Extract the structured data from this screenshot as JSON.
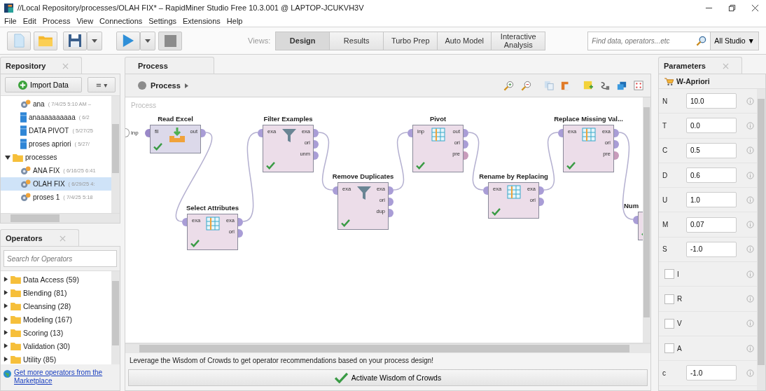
{
  "window": {
    "title": "//Local Repository/processes/OLAH FIX* – RapidMiner Studio Free 10.3.001 @ LAPTOP-JCUKVH3V"
  },
  "menu": [
    "File",
    "Edit",
    "Process",
    "View",
    "Connections",
    "Settings",
    "Extensions",
    "Help"
  ],
  "toolbar": {
    "stop_disabled": true,
    "views_label": "Views:",
    "views": [
      {
        "label": "Design",
        "selected": true
      },
      {
        "label": "Results",
        "selected": false
      },
      {
        "label": "Turbo Prep",
        "selected": false
      },
      {
        "label": "Auto Model",
        "selected": false
      },
      {
        "label": "Interactive Analysis",
        "selected": false
      }
    ],
    "search": {
      "placeholder": "Find data, operators...etc"
    },
    "scope": "All Studio ▼"
  },
  "repository": {
    "tab": "Repository",
    "import_button": "Import Data",
    "menu_button": "≡ ▾",
    "tree": [
      {
        "children": [
          {
            "name": "ana",
            "meta": "( 7/4/25 5:10 AM –",
            "kind": "process",
            "selected": false
          },
          {
            "name": "anaaaaaaaaaa",
            "meta": "( 6/2",
            "kind": "data",
            "selected": false
          },
          {
            "name": "DATA PIVOT",
            "meta": "( 5/27/25",
            "kind": "data",
            "selected": false
          },
          {
            "name": "proses apriori",
            "meta": "( 5/27/",
            "kind": "data",
            "selected": false
          }
        ]
      },
      {
        "name": "processes",
        "kind": "folder",
        "expanded": true,
        "selected": false,
        "children": [
          {
            "name": "ANA FIX",
            "meta": "( 6/16/25 6:41",
            "kind": "process",
            "selected": false
          },
          {
            "name": "OLAH FIX",
            "meta": "( 6/29/25 4:",
            "kind": "process",
            "selected": true
          },
          {
            "name": "proses 1",
            "meta": "( 7/4/25 5:18",
            "kind": "process",
            "selected": false
          }
        ]
      }
    ]
  },
  "operators": {
    "tab": "Operators",
    "search": {
      "placeholder": "Search for Operators"
    },
    "groups": [
      {
        "label": "Data Access (59)",
        "expanded": false
      },
      {
        "label": "Blending (81)",
        "expanded": false
      },
      {
        "label": "Cleansing (28)",
        "expanded": false
      },
      {
        "label": "Modeling (167)",
        "expanded": false
      },
      {
        "label": "Scoring (13)",
        "expanded": false
      },
      {
        "label": "Validation (30)",
        "expanded": false
      },
      {
        "label": "Utility (85)",
        "expanded": false
      }
    ],
    "marketplace_link": "Get more operators from the Marketplace"
  },
  "process": {
    "tab": "Process",
    "breadcrumb": "Process",
    "canvas_label": "Process",
    "input_port": "inp",
    "nodes": [
      {
        "title": "Read Excel",
        "kind": "import",
        "color": "#dcd9ea",
        "ok": true,
        "inputs": [
          {
            "label": "fil",
            "color": "#9a88c8"
          }
        ],
        "outputs": [
          {
            "label": "out",
            "color": "#a99dd6"
          }
        ]
      },
      {
        "title": "Filter Examples",
        "kind": "filter",
        "color": "#ecdde9",
        "ok": true,
        "inputs": [
          {
            "label": "exa",
            "color": "#a99dd6"
          }
        ],
        "outputs": [
          {
            "label": "exa",
            "color": "#a99dd6"
          },
          {
            "label": "ori",
            "color": "#a99dd6"
          },
          {
            "label": "unm",
            "color": "#a99dd6"
          }
        ]
      },
      {
        "title": "Select Attributes",
        "kind": "table",
        "color": "#ecdde9",
        "ok": true,
        "inputs": [
          {
            "label": "exa",
            "color": "#a99dd6"
          }
        ],
        "outputs": [
          {
            "label": "exa",
            "color": "#a99dd6"
          },
          {
            "label": "ori",
            "color": "#a99dd6"
          }
        ]
      },
      {
        "title": "Remove Duplicates",
        "kind": "filter",
        "color": "#ecdde9",
        "ok": true,
        "inputs": [
          {
            "label": "exa",
            "color": "#a99dd6"
          }
        ],
        "outputs": [
          {
            "label": "exa",
            "color": "#a99dd6"
          },
          {
            "label": "ori",
            "color": "#a99dd6"
          },
          {
            "label": "dup",
            "color": "#a99dd6"
          }
        ]
      },
      {
        "title": "Pivot",
        "kind": "table",
        "color": "#ecdde9",
        "ok": true,
        "inputs": [
          {
            "label": "inp",
            "color": "#a99dd6"
          }
        ],
        "outputs": [
          {
            "label": "out",
            "color": "#a99dd6"
          },
          {
            "label": "ori",
            "color": "#a99dd6"
          },
          {
            "label": "pre",
            "color": "#c89bbb"
          }
        ]
      },
      {
        "title": "Rename by Replacing",
        "kind": "table",
        "color": "#ecdde9",
        "ok": true,
        "inputs": [
          {
            "label": "exa",
            "color": "#a99dd6"
          }
        ],
        "outputs": [
          {
            "label": "exa",
            "color": "#a99dd6"
          },
          {
            "label": "ori",
            "color": "#a99dd6"
          }
        ]
      },
      {
        "title": "Replace Missing Val...",
        "kind": "table",
        "color": "#ecdde9",
        "ok": true,
        "inputs": [
          {
            "label": "exa",
            "color": "#a99dd6"
          }
        ],
        "outputs": [
          {
            "label": "exa",
            "color": "#a99dd6"
          },
          {
            "label": "ori",
            "color": "#a99dd6"
          },
          {
            "label": "pre",
            "color": "#c89bbb"
          }
        ]
      },
      {
        "title": "Num",
        "kind": "partial",
        "color": "#ecdde9",
        "ok": true,
        "inputs": [
          {
            "color": "#a99dd6"
          }
        ]
      }
    ],
    "wisdom_text": "Leverage the Wisdom of Crowds to get operator recommendations based on your process design!",
    "wisdom_button": "Activate Wisdom of Crowds"
  },
  "parameters": {
    "tab": "Parameters",
    "operator": "W-Apriori",
    "rows": [
      {
        "kind": "field",
        "label": "N",
        "value": "10.0"
      },
      {
        "kind": "field",
        "label": "T",
        "value": "0.0"
      },
      {
        "kind": "field",
        "label": "C",
        "value": "0.5"
      },
      {
        "kind": "field",
        "label": "D",
        "value": "0.6"
      },
      {
        "kind": "field",
        "label": "U",
        "value": "1.0"
      },
      {
        "kind": "field",
        "label": "M",
        "value": "0.07"
      },
      {
        "kind": "field",
        "label": "S",
        "value": "-1.0"
      },
      {
        "kind": "checkbox",
        "label": "I",
        "checked": false
      },
      {
        "kind": "checkbox",
        "label": "R",
        "checked": false
      },
      {
        "kind": "checkbox",
        "label": "V",
        "checked": false
      },
      {
        "kind": "checkbox",
        "label": "A",
        "checked": false
      },
      {
        "kind": "field",
        "label": "c",
        "value": "-1.0"
      }
    ]
  }
}
